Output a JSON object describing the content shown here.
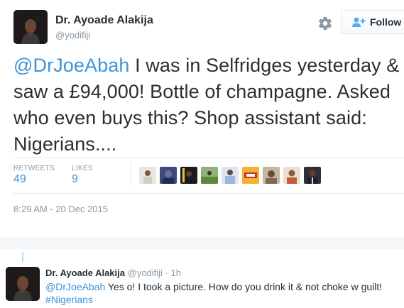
{
  "tweet": {
    "author_name": "Dr. Ayoade Alakija",
    "author_handle": "@yodifiji",
    "follow_label": "Follow",
    "mention": "@DrJoeAbah",
    "text": " I was in Selfridges yesterday & saw a £94,000! Bottle of champagne. Asked who even buys this? Shop assistant said: Nigerians....",
    "stats": {
      "retweets_label": "RETWEETS",
      "retweets_value": "49",
      "likes_label": "LIKES",
      "likes_value": "9"
    },
    "timestamp": "8:29 AM - 20 Dec 2015"
  },
  "reply": {
    "author_name": "Dr. Ayoade Alakija",
    "author_handle": "@yodifiji",
    "separator": "·",
    "time": "1h",
    "mention": "@DrJoeAbah",
    "text": " Yes o! I took a picture. How do you drink it & not choke w guilt!",
    "hashtag": "#Nigerians"
  },
  "icons": {
    "settings": "gear-icon",
    "follow": "person-plus-icon"
  },
  "colors": {
    "link": "#3b94d9",
    "text": "#292f33",
    "muted": "#8899a6",
    "border": "#e1e8ed"
  }
}
